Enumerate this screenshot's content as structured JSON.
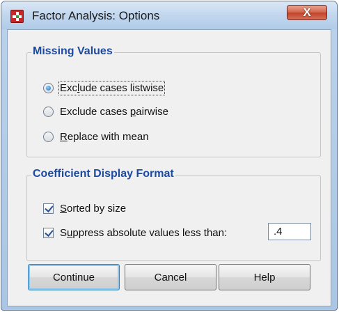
{
  "window": {
    "title": "Factor Analysis: Options",
    "close_label": "X"
  },
  "missing_values": {
    "legend": "Missing Values",
    "options": [
      {
        "pre": "Exc",
        "key": "l",
        "post": "ude cases listwise",
        "selected": true
      },
      {
        "pre": "Exclude cases ",
        "key": "p",
        "post": "airwise",
        "selected": false
      },
      {
        "pre": "",
        "key": "R",
        "post": "eplace with mean",
        "selected": false
      }
    ]
  },
  "coefficient_display": {
    "legend": "Coefficient Display Format",
    "sorted": {
      "pre": "",
      "key": "S",
      "post": "orted by size",
      "checked": true
    },
    "suppress": {
      "pre": "S",
      "key": "u",
      "post": "ppress absolute values less than:",
      "checked": true
    },
    "suppress_value": ".4"
  },
  "buttons": {
    "continue": "Continue",
    "cancel": "Cancel",
    "help": "Help"
  },
  "colors": {
    "legend_text": "#1c4aa1",
    "dialog_background": "#f0f0f0"
  }
}
